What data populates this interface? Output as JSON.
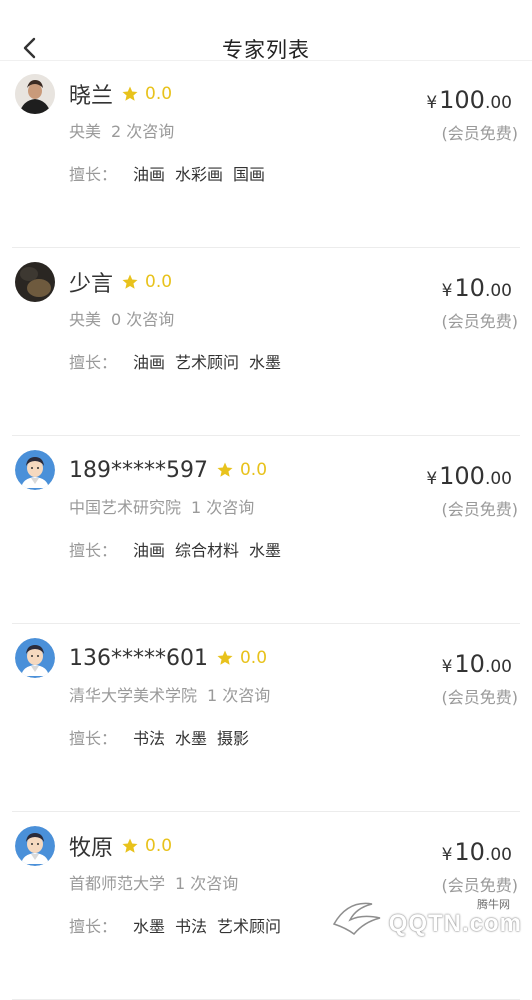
{
  "header": {
    "title": "专家列表"
  },
  "labels": {
    "skills_label": "擅长："
  },
  "colors": {
    "star": "#e8c21c",
    "text": "#333333",
    "muted": "#9a9a9a"
  },
  "experts": [
    {
      "name": "晓兰",
      "rating": "0.0",
      "org": "央美",
      "consults": "2 次咨询",
      "price_int": "100",
      "price_dec": ".00",
      "currency": "¥",
      "free_note": "(会员免费)",
      "skills": [
        "油画",
        "水彩画",
        "国画"
      ],
      "avatar": "photo-man"
    },
    {
      "name": "少言",
      "rating": "0.0",
      "org": "央美",
      "consults": "0 次咨询",
      "price_int": "10",
      "price_dec": ".00",
      "currency": "¥",
      "free_note": "(会员免费)",
      "skills": [
        "油画",
        "艺术顾问",
        "水墨"
      ],
      "avatar": "photo-dark"
    },
    {
      "name": "189*****597",
      "rating": "0.0",
      "org": "中国艺术研究院",
      "consults": "1 次咨询",
      "price_int": "100",
      "price_dec": ".00",
      "currency": "¥",
      "free_note": "(会员免费)",
      "skills": [
        "油画",
        "综合材料",
        "水墨"
      ],
      "avatar": "default-avatar"
    },
    {
      "name": "136*****601",
      "rating": "0.0",
      "org": "清华大学美术学院",
      "consults": "1 次咨询",
      "price_int": "10",
      "price_dec": ".00",
      "currency": "¥",
      "free_note": "(会员免费)",
      "skills": [
        "书法",
        "水墨",
        "摄影"
      ],
      "avatar": "default-avatar"
    },
    {
      "name": "牧原",
      "rating": "0.0",
      "org": "首都师范大学",
      "consults": "1 次咨询",
      "price_int": "10",
      "price_dec": ".00",
      "currency": "¥",
      "free_note": "(会员免费)",
      "skills": [
        "水墨",
        "书法",
        "艺术顾问"
      ],
      "avatar": "default-avatar"
    }
  ],
  "watermark": {
    "text": "QQTN.com",
    "small": "腾牛网"
  }
}
